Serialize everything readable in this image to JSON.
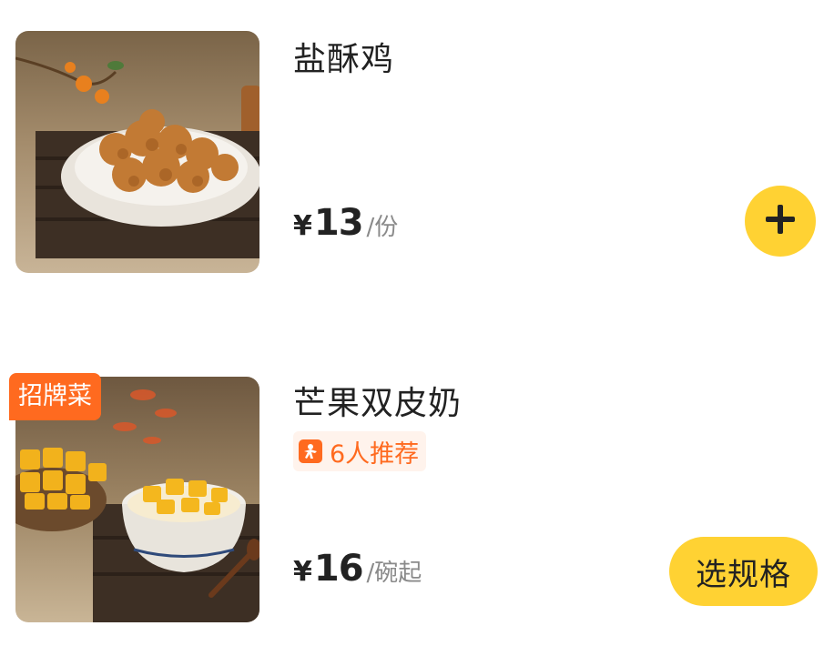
{
  "items": [
    {
      "title": "盐酥鸡",
      "price": {
        "currency": "¥",
        "amount": "13",
        "unit": "/份"
      },
      "action": {
        "type": "add",
        "icon": "plus-icon"
      },
      "image": "fried-chicken-photo"
    },
    {
      "badge": "招牌菜",
      "title": "芒果双皮奶",
      "recommend": {
        "icon": "thumbs-up-icon",
        "text": "6人推荐"
      },
      "price": {
        "currency": "¥",
        "amount": "16",
        "unit": "/碗起"
      },
      "action": {
        "type": "select",
        "label": "选规格"
      },
      "image": "mango-milk-pudding-photo"
    }
  ],
  "colors": {
    "accent": "#ffd233",
    "badge": "#ff6a1f",
    "unit": "#8a8a8a"
  }
}
